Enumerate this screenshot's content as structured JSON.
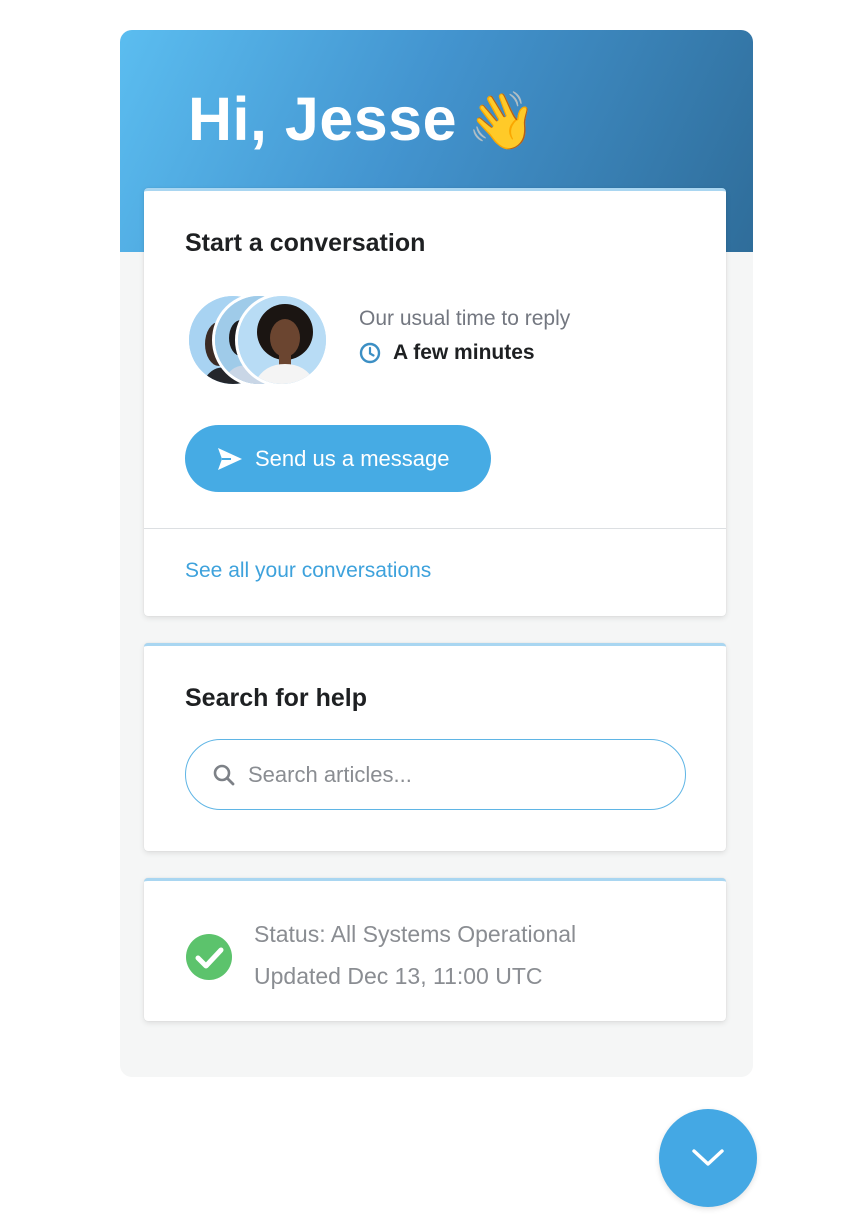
{
  "header": {
    "greeting": "Hi, Jesse",
    "wave_emoji": "👋"
  },
  "conversation_card": {
    "title": "Start a conversation",
    "reply_label": "Our usual time to reply",
    "reply_time": "A few minutes",
    "clock_icon": "clock-icon",
    "send_button_label": "Send us a message",
    "send_icon": "paper-plane-icon",
    "see_all_link": "See all your conversations"
  },
  "search_card": {
    "title": "Search for help",
    "placeholder": "Search articles...",
    "value": "",
    "icon": "search-icon"
  },
  "status_card": {
    "status_text": "Status: All Systems Operational",
    "updated_text": "Updated Dec 13, 11:00 UTC",
    "icon": "check-circle-icon"
  },
  "launcher": {
    "icon": "chevron-down-icon"
  },
  "colors": {
    "accent": "#46abe4",
    "link": "#3ea2dc",
    "header_gradient_start": "#5bbdf0",
    "header_gradient_end": "#2f6d9a",
    "status_ok": "#5cc36c"
  }
}
